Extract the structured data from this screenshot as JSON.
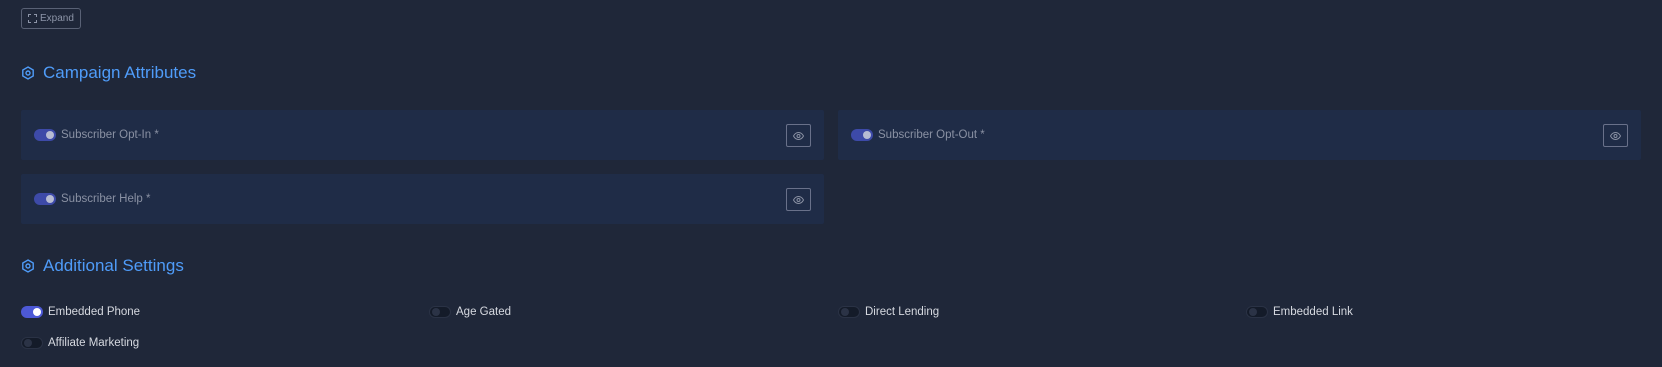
{
  "toolbar": {
    "expand_label": "Expand"
  },
  "campaign_attributes": {
    "title": "Campaign Attributes",
    "items": [
      {
        "label": "Subscriber Opt-In *",
        "enabled": true
      },
      {
        "label": "Subscriber Opt-Out *",
        "enabled": true
      },
      {
        "label": "Subscriber Help *",
        "enabled": true
      }
    ]
  },
  "additional_settings": {
    "title": "Additional Settings",
    "items": [
      {
        "label": "Embedded Phone",
        "enabled": true
      },
      {
        "label": "Age Gated",
        "enabled": false
      },
      {
        "label": "Direct Lending",
        "enabled": false
      },
      {
        "label": "Embedded Link",
        "enabled": false
      },
      {
        "label": "Affiliate Marketing",
        "enabled": false
      }
    ]
  },
  "icons": {
    "expand": "expand-icon",
    "section": "gear-icon",
    "view": "eye-icon"
  },
  "colors": {
    "background": "#1f2739",
    "card": "#1f2c47",
    "accent": "#4f9cf9",
    "toggle_on": "#4d59d6"
  }
}
